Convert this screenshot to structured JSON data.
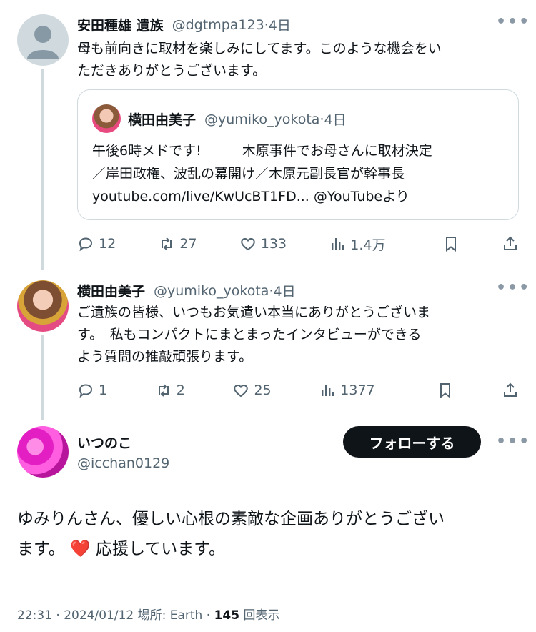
{
  "tweet1": {
    "name": "安田種雄 遺族",
    "handle": "@dgtmpa123",
    "time": "4日",
    "text": "母も前向きに取材を楽しみにしてます。このような機会をいただきありがとうございます。",
    "text_line1": "母も前向きに取材を楽しみにしてます。このような機会をい",
    "text_line2": "ただきありがとうございます。",
    "quote": {
      "name": "横田由美子",
      "handle": "@yumiko_yokota",
      "time": "4日",
      "line1": "午後6時メドです!　　　木原事件でお母さんに取材決定",
      "line2": "／岸田政権、波乱の幕開け／木原元副長官が幹事長",
      "line3": "youtube.com/live/KwUcBT1FD... @YouTubeより"
    },
    "replies": "12",
    "retweets": "27",
    "likes": "133",
    "views": "1.4万"
  },
  "tweet2": {
    "name": "横田由美子",
    "handle": "@yumiko_yokota",
    "time": "4日",
    "text_line1": "ご遺族の皆様、いつもお気遣い本当にありがとうございま",
    "text_line2": "す。　私もコンパクトにまとまったインタビューができる",
    "text_line3": "よう質問の推敲頑張ります。",
    "replies": "1",
    "retweets": "2",
    "likes": "25",
    "views": "1377"
  },
  "main_tweet": {
    "name": "いつのこ",
    "handle": "@icchan0129",
    "follow_label": "フォローする",
    "text_line1": "ゆみりんさん、優しい心根の素敵な企画ありがとうござい",
    "text_line2_pre": "ます。",
    "text_line2_emoji": "❤️",
    "text_line2_post": "応援しています。",
    "meta_time": "22:31",
    "meta_date": "2024/01/12",
    "meta_location": "場所: Earth",
    "meta_views_count": "145",
    "meta_views_label": "回表示"
  },
  "separator": " · ",
  "colors": {
    "text": "#0f1419",
    "secondary": "#536471",
    "border": "#cfd9de",
    "heart": "#e0245e"
  },
  "icons": [
    "reply-icon",
    "retweet-icon",
    "like-icon",
    "views-icon",
    "bookmark-icon",
    "share-icon",
    "more-icon",
    "default-avatar-icon"
  ]
}
